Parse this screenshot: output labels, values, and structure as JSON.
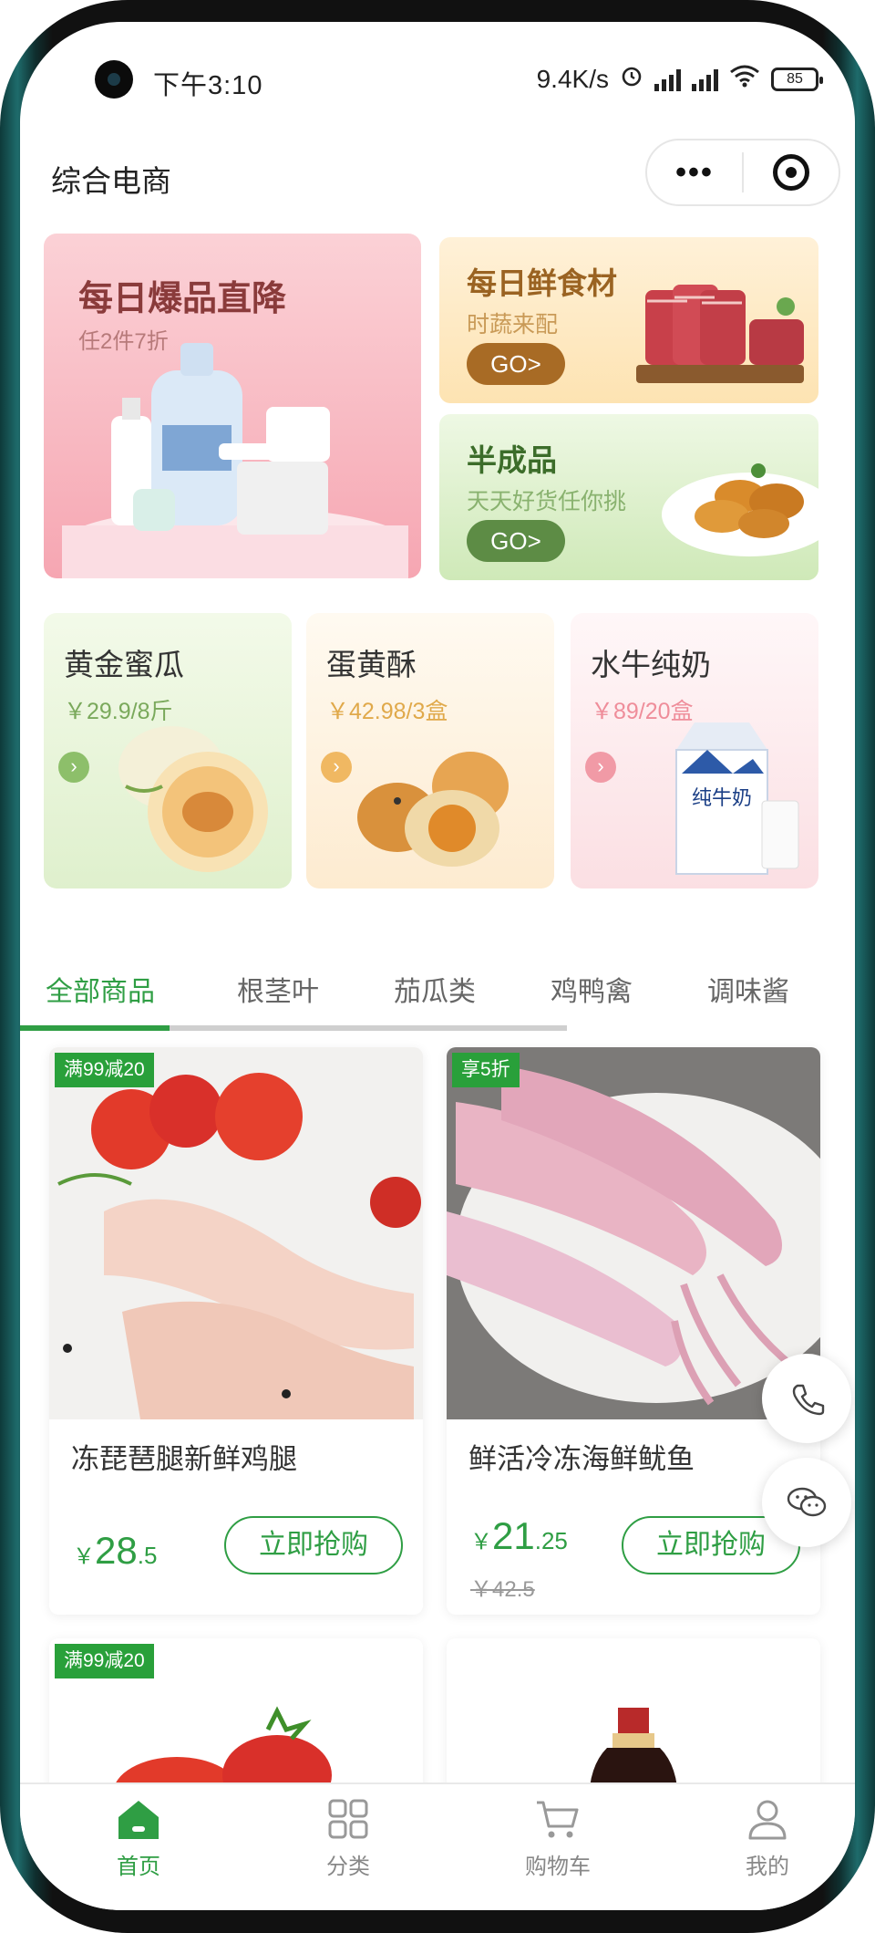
{
  "status_bar": {
    "time": "下午3:10",
    "network_speed": "9.4K/s",
    "battery": "85"
  },
  "nav": {
    "title": "综合电商",
    "more_icon": "more-dots-icon",
    "close_icon": "target-icon"
  },
  "promos": {
    "daily_deal": {
      "title": "每日爆品直降",
      "subtitle": "任2件7折"
    },
    "fresh_food": {
      "title": "每日鲜食材",
      "subtitle": "时蔬来配",
      "button": "GO>"
    },
    "semi_finished": {
      "title": "半成品",
      "subtitle": "天天好货任你挑",
      "button": "GO>"
    }
  },
  "featured_products": [
    {
      "name": "黄金蜜瓜",
      "price": "￥29.9/8斤"
    },
    {
      "name": "蛋黄酥",
      "price": "￥42.98/3盒"
    },
    {
      "name": "水牛纯奶",
      "price": "￥89/20盒",
      "package_text": "纯牛奶"
    }
  ],
  "category_tabs": [
    "全部商品",
    "根茎叶",
    "茄瓜类",
    "鸡鸭禽",
    "调味酱"
  ],
  "active_tab_index": 0,
  "goods": [
    {
      "tag": "满99减20",
      "name": "冻琵琶腿新鲜鸡腿",
      "price_symbol": "￥",
      "price_int": "28",
      "price_dec": ".5",
      "old_price": "",
      "button": "立即抢购"
    },
    {
      "tag": "享5折",
      "name": "鲜活冷冻海鲜鱿鱼",
      "price_symbol": "￥",
      "price_int": "21",
      "price_dec": ".25",
      "old_price": "￥42.5",
      "button": "立即抢购"
    },
    {
      "tag": "满99减20"
    },
    {
      "tag": ""
    }
  ],
  "floating": {
    "phone_icon": "phone-icon",
    "chat_icon": "chat-icon"
  },
  "tabbar": [
    {
      "label": "首页",
      "icon": "home-icon"
    },
    {
      "label": "分类",
      "icon": "category-grid-icon"
    },
    {
      "label": "购物车",
      "icon": "cart-icon"
    },
    {
      "label": "我的",
      "icon": "user-icon"
    }
  ],
  "colors": {
    "accent": "#2f9e44",
    "tag_green": "#29a03a"
  }
}
